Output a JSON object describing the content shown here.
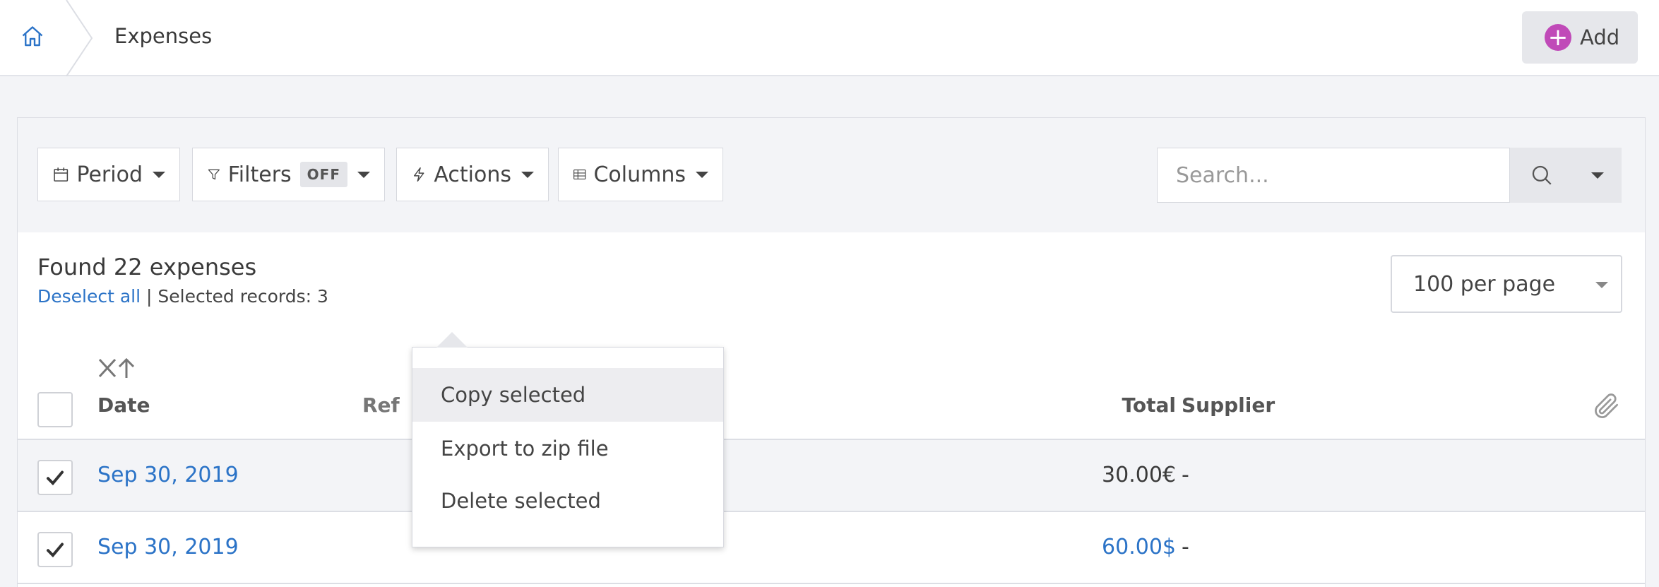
{
  "breadcrumb": {
    "current": "Expenses"
  },
  "header": {
    "add_label": "Add"
  },
  "toolbar": {
    "period_label": "Period",
    "filters_label": "Filters",
    "filters_state": "OFF",
    "actions_label": "Actions",
    "columns_label": "Columns",
    "search_placeholder": "Search..."
  },
  "summary": {
    "found_text": "Found 22 expenses",
    "deselect_label": "Deselect all",
    "selected_text": "| Selected records: 3"
  },
  "pagination": {
    "per_page": "100 per page"
  },
  "actions_menu": {
    "items": [
      "Copy selected",
      "Export to zip file",
      "Delete selected"
    ]
  },
  "table": {
    "columns": {
      "date": "Date",
      "reference": "Ref",
      "total": "Total",
      "supplier": "Supplier"
    },
    "rows": [
      {
        "date": "Sep 30, 2019",
        "total": "30.00€",
        "supplier": "-",
        "checked": true
      },
      {
        "date": "Sep 30, 2019",
        "total": "60.00$",
        "supplier": "-",
        "checked": true
      }
    ]
  },
  "colors": {
    "link": "#2b73c7",
    "add_accent": "#c04ab8",
    "page_bg": "#f3f4f7"
  },
  "icons": [
    "home-icon",
    "calendar-icon",
    "filter-icon",
    "lightning-icon",
    "columns-icon",
    "search-icon",
    "sort-icon",
    "paperclip-icon",
    "checkmark-icon"
  ]
}
